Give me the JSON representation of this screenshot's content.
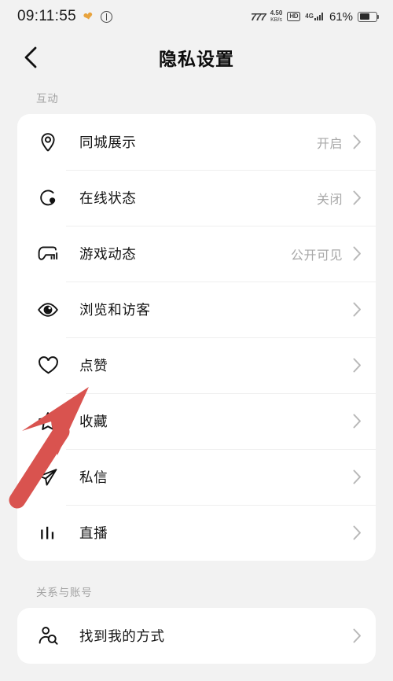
{
  "statusbar": {
    "time": "09:11:55",
    "heart_icon": "heart-icon",
    "pause_icon": "pause-circle-icon",
    "signal_icon": "signal-strength-icon",
    "data_rate_value": "4.50",
    "data_rate_unit": "KB/s",
    "hd_badge": "HD",
    "network_type": "4G",
    "battery_percent": "61%",
    "battery_level": 61
  },
  "navbar": {
    "back_icon": "back-chevron-icon",
    "title": "隐私设置"
  },
  "sections": [
    {
      "label": "互动",
      "rows": [
        {
          "icon": "location-pin-icon",
          "label": "同城展示",
          "value": "开启"
        },
        {
          "icon": "online-status-icon",
          "label": "在线状态",
          "value": "关闭"
        },
        {
          "icon": "gamepad-icon",
          "label": "游戏动态",
          "value": "公开可见"
        },
        {
          "icon": "eye-icon",
          "label": "浏览和访客",
          "value": ""
        },
        {
          "icon": "heart-outline-icon",
          "label": "点赞",
          "value": ""
        },
        {
          "icon": "star-outline-icon",
          "label": "收藏",
          "value": ""
        },
        {
          "icon": "paper-plane-icon",
          "label": "私信",
          "value": ""
        },
        {
          "icon": "live-bars-icon",
          "label": "直播",
          "value": ""
        }
      ]
    },
    {
      "label": "关系与账号",
      "rows": [
        {
          "icon": "person-search-icon",
          "label": "找到我的方式",
          "value": ""
        }
      ]
    }
  ],
  "annotation": {
    "type": "arrow",
    "color": "#d9534f",
    "points_to": "点赞"
  },
  "colors": {
    "page_background": "#f2f2f2",
    "card_background": "#ffffff",
    "primary_text": "#141414",
    "secondary_text": "#a8a8a8",
    "section_label": "#a3a3a3",
    "divider": "#efefef",
    "annotation_red": "#d9534f",
    "status_accent": "#e8a33d"
  }
}
